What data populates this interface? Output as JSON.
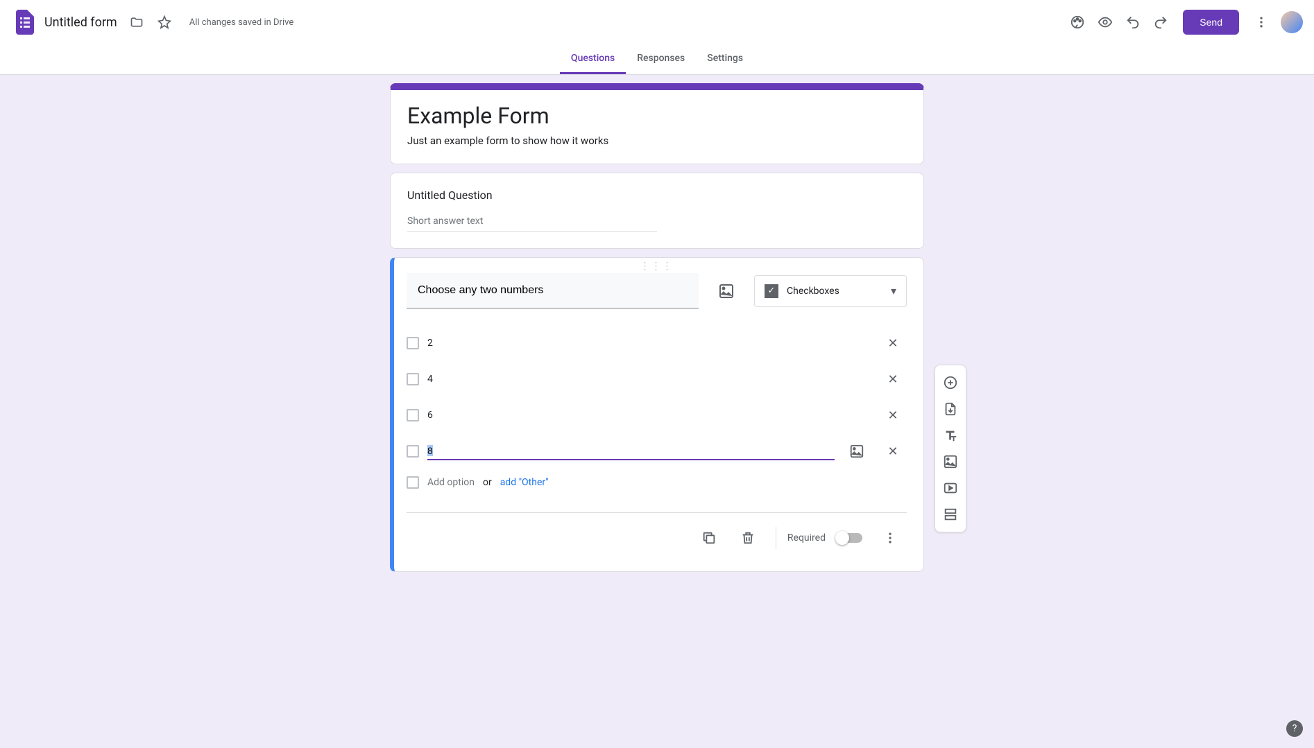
{
  "header": {
    "form_name": "Untitled form",
    "save_status": "All changes saved in Drive",
    "send_label": "Send"
  },
  "tabs": {
    "questions": "Questions",
    "responses": "Responses",
    "settings": "Settings"
  },
  "form": {
    "title": "Example Form",
    "description": "Just an example form to show how it works"
  },
  "q1": {
    "title": "Untitled Question",
    "placeholder": "Short answer text"
  },
  "q2": {
    "title": "Choose any two numbers",
    "type_label": "Checkboxes",
    "options": [
      "2",
      "4",
      "6",
      "8"
    ],
    "add_option": "Add option",
    "or": "or",
    "add_other": "add \"Other\"",
    "required": "Required"
  }
}
